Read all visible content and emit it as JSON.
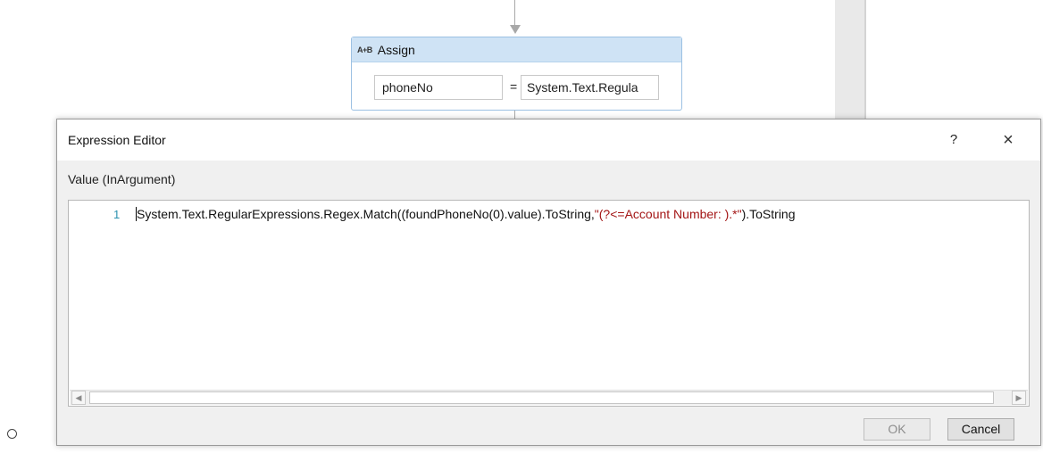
{
  "assign": {
    "icon": "A+B",
    "title": "Assign",
    "to_value": "phoneNo",
    "equals": "=",
    "value_value": "System.Text.Regula"
  },
  "dialog": {
    "title": "Expression Editor",
    "help": "?",
    "close": "×",
    "value_label": "Value (InArgument)",
    "line_number": "1",
    "code_pre": "System.Text.RegularExpressions.Regex.Match((foundPhoneNo(0).value).ToString,",
    "code_string": "\"(?<=Account Number: ).*\"",
    "code_post": ").ToString",
    "scroll_left": "◀",
    "scroll_right": "▶",
    "ok_label": "OK",
    "cancel_label": "Cancel"
  },
  "icons": {
    "arrow": "arrow-down-icon",
    "bullet": "circle-bullet-icon"
  }
}
